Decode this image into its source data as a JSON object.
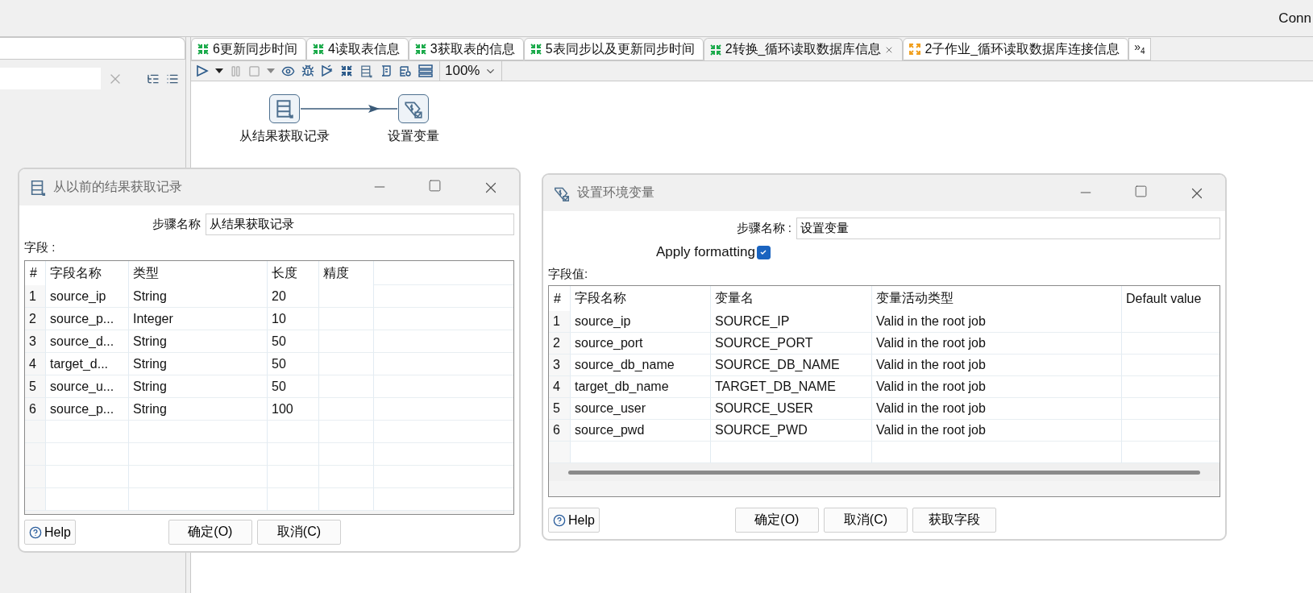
{
  "app_bar": {
    "text": "Conn"
  },
  "tabs": [
    {
      "label": "6更新同步时间",
      "kind": "transformation",
      "selected": false
    },
    {
      "label": "4读取表信息",
      "kind": "transformation",
      "selected": false
    },
    {
      "label": "3获取表的信息",
      "kind": "transformation",
      "selected": false
    },
    {
      "label": "5表同步以及更新同步时间",
      "kind": "transformation",
      "selected": false
    },
    {
      "label": "2转换_循环读取数据库信息",
      "kind": "transformation",
      "selected": true
    },
    {
      "label": "2子作业_循环读取数据库连接信息",
      "kind": "job",
      "selected": false
    }
  ],
  "tab_overflow": {
    "mark": "»",
    "count": "4"
  },
  "toolbar": {
    "zoom": "100%"
  },
  "canvas": {
    "steps": [
      {
        "label": "从结果获取记录",
        "kind": "get-rows"
      },
      {
        "label": "设置变量",
        "kind": "set-variables"
      }
    ]
  },
  "dialogs": [
    {
      "kind": "get-rows",
      "title": "从以前的结果获取记录",
      "step_name_label": "步骤名称",
      "step_name": "从结果获取记录",
      "table_label": "字段 :",
      "columns": [
        "#",
        "字段名称",
        "类型",
        "长度",
        "精度"
      ],
      "rows": [
        [
          "1",
          "source_ip",
          "String",
          "20"
        ],
        [
          "2",
          "source_p...",
          "Integer",
          "10"
        ],
        [
          "3",
          "source_d...",
          "String",
          "50"
        ],
        [
          "4",
          "target_d...",
          "String",
          "50"
        ],
        [
          "5",
          "source_u...",
          "String",
          "50"
        ],
        [
          "6",
          "source_p...",
          "String",
          "100"
        ]
      ],
      "help": "Help",
      "buttons": [
        "确定(O)",
        "取消(C)"
      ]
    },
    {
      "kind": "set-variables",
      "title": "设置环境变量",
      "step_name_label": "步骤名称 :",
      "step_name": "设置变量",
      "apply_formatting": {
        "label": "Apply formatting",
        "checked": true
      },
      "table_label": "字段值:",
      "columns": [
        "#",
        "字段名称",
        "变量名",
        "变量活动类型",
        "Default value"
      ],
      "rows": [
        [
          "1",
          "source_ip",
          "SOURCE_IP",
          "Valid in the root job"
        ],
        [
          "2",
          "source_port",
          "SOURCE_PORT",
          "Valid in the root job"
        ],
        [
          "3",
          "source_db_name",
          "SOURCE_DB_NAME",
          "Valid in the root job"
        ],
        [
          "4",
          "target_db_name",
          "TARGET_DB_NAME",
          "Valid in the root job"
        ],
        [
          "5",
          "source_user",
          "SOURCE_USER",
          "Valid in the root job"
        ],
        [
          "6",
          "source_pwd",
          "SOURCE_PWD",
          "Valid in the root job"
        ]
      ],
      "help": "Help",
      "buttons": [
        "确定(O)",
        "取消(C)",
        "获取字段"
      ]
    }
  ]
}
